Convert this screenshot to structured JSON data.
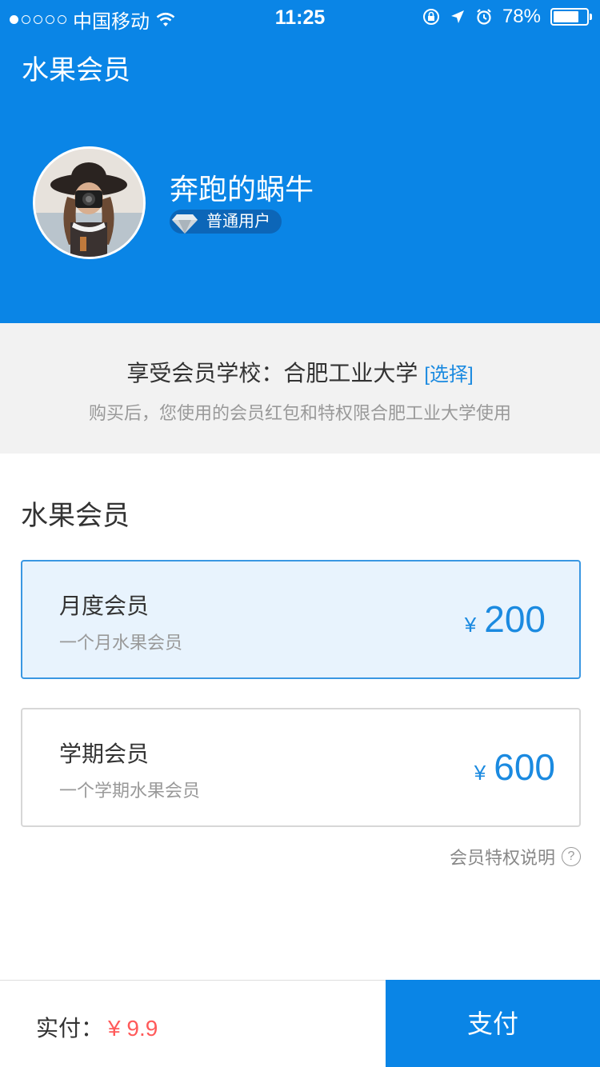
{
  "status_bar": {
    "carrier": "中国移动",
    "time": "11:25",
    "battery": "78%",
    "battery_level": 0.78
  },
  "header": {
    "title": "水果会员",
    "username": "奔跑的蜗牛",
    "badge": "普通用户"
  },
  "school": {
    "label": "享受会员学校：合肥工业大学",
    "select": "[选择]",
    "note": "购买后，您使用的会员红包和特权限合肥工业大学使用"
  },
  "section_title": "水果会员",
  "plans": [
    {
      "name": "月度会员",
      "desc": "一个月水果会员",
      "currency": "¥",
      "price": "200",
      "selected": true
    },
    {
      "name": "学期会员",
      "desc": "一个学期水果会员",
      "currency": "¥",
      "price": "600",
      "selected": false
    }
  ],
  "privilege_link": "会员特权说明",
  "privilege_icon": "?",
  "bottom": {
    "paid_label": "实付：",
    "paid_value": "¥ 9.9",
    "pay_button": "支付"
  },
  "colors": {
    "brand_blue": "#0a85e6",
    "price_blue": "#1b8ae0",
    "price_red": "#ff5a5a"
  }
}
